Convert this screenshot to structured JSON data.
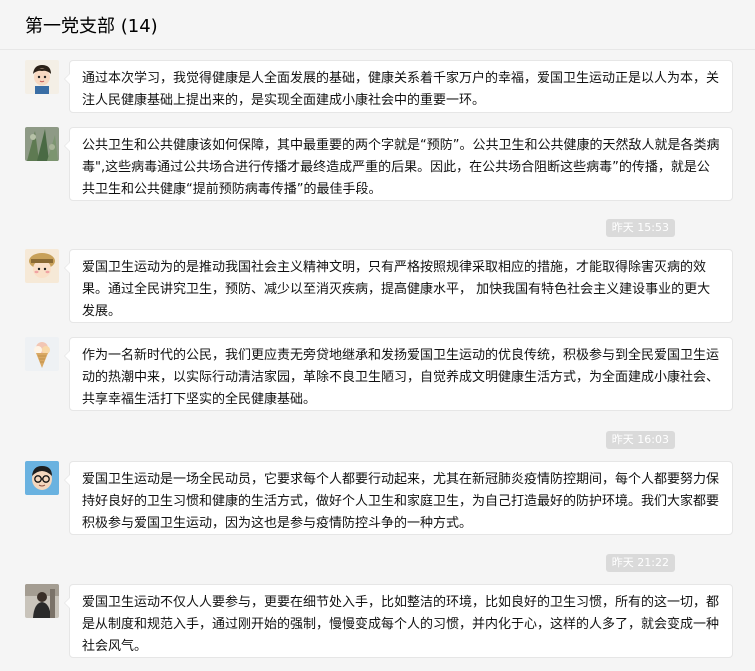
{
  "header": {
    "title": "第一党支部 (14)"
  },
  "messages": [
    {
      "avatar": "cartoon-boy-avatar",
      "text": "通过本次学习，我觉得健康是人全面发展的基础，健康关系着千家万户的幸福，爱国卫生运动正是以人为本，关注人民健康基础上提出来的，是实现全面建成小康社会中的重要一环。"
    },
    {
      "avatar": "plant-photo-avatar",
      "text": "公共卫生和公共健康该如何保障，其中最重要的两个字就是“预防”。公共卫生和公共健康的天然敌人就是各类病毒\",这些病毒通过公共场合进行传播才最终造成严重的后果。因此，在公共场合阻断这些病毒”的传播，就是公共卫生和公共健康“提前预防病毒传播”的最佳手段。"
    },
    {
      "avatar": "cartoon-kid-hat-avatar",
      "text": "爱国卫生运动为的是推动我国社会主义精神文明，只有严格按照规律采取相应的措施，才能取得除害灭病的效果。通过全民讲究卫生，预防、减少以至消灭疾病，提高健康水平， 加快我国有特色社会主义建设事业的更大发展。"
    },
    {
      "avatar": "ice-cream-avatar",
      "text": "作为一名新时代的公民，我们更应责无旁贷地继承和发扬爱国卫生运动的优良传统，积极参与到全民爱国卫生运动的热潮中来，以实际行动清洁家园，革除不良卫生陋习，自觉养成文明健康生活方式，为全面建成小康社会、共享幸福生活打下坚实的全民健康基础。"
    },
    {
      "avatar": "glasses-man-avatar",
      "text": "爱国卫生运动是一场全民动员，它要求每个人都要行动起来，尤其在新冠肺炎疫情防控期间，每个人都要努力保持好良好的卫生习惯和健康的生活方式，做好个人卫生和家庭卫生，为自己打造最好的防护环境。我们大家都要积极参与爱国卫生运动，因为这也是参与疫情防控斗争的一种方式。"
    },
    {
      "avatar": "person-photo-avatar",
      "text": "爱国卫生运动不仅人人要参与，更要在细节处入手，比如整洁的环境，比如良好的卫生习惯，所有的这一切，都是从制度和规范入手，通过刚开始的强制，慢慢变成每个人的习惯，并内化于心，这样的人多了，就会变成一种社会风气。"
    }
  ],
  "timestamps": [
    "昨天 15:53",
    "昨天 16:03",
    "昨天 21:22"
  ]
}
